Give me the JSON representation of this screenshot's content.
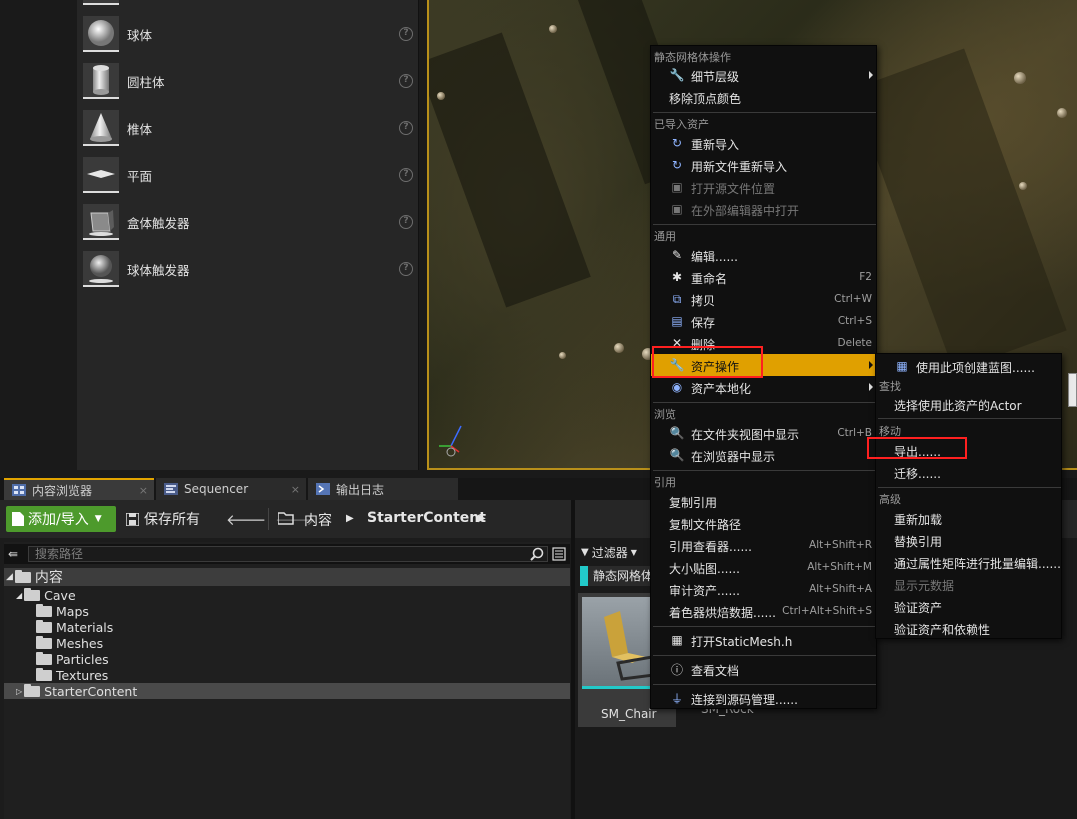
{
  "place_actors": {
    "items": [
      {
        "label": "球体",
        "icon": "sphere-icon"
      },
      {
        "label": "圆柱体",
        "icon": "cylinder-icon"
      },
      {
        "label": "椎体",
        "icon": "cone-icon"
      },
      {
        "label": "平面",
        "icon": "plane-icon"
      },
      {
        "label": "盒体触发器",
        "icon": "box-trigger-icon"
      },
      {
        "label": "球体触发器",
        "icon": "sphere-trigger-icon"
      }
    ],
    "help_glyph": "?"
  },
  "tabs": [
    {
      "label": "内容浏览器",
      "close": "×"
    },
    {
      "label": "Sequencer",
      "close": "×"
    },
    {
      "label": "输出日志",
      "close": "×"
    }
  ],
  "toolbar": {
    "add_import": "添加/导入",
    "save_all": "保存所有",
    "breadcrumb": [
      "内容",
      "StarterContent"
    ]
  },
  "paths": {
    "search_placeholder": "搜索路径",
    "tree": [
      {
        "label": "内容",
        "level": 0
      },
      {
        "label": "Cave",
        "level": 1
      },
      {
        "label": "Maps",
        "level": 2
      },
      {
        "label": "Materials",
        "level": 2
      },
      {
        "label": "Meshes",
        "level": 2
      },
      {
        "label": "Particles",
        "level": 2
      },
      {
        "label": "Textures",
        "level": 2
      },
      {
        "label": "StarterContent",
        "level": 1
      }
    ]
  },
  "assets": {
    "filter_label": "过滤器",
    "type_header": "静态网格体",
    "tiles": [
      "SM_Chair",
      "SM_Rock"
    ]
  },
  "context_menu": {
    "sections": {
      "mesh_ops": "静态网格体操作",
      "imported": "已导入资产",
      "common": "通用",
      "browse": "浏览",
      "references": "引用"
    },
    "items": {
      "lod": "细节层级",
      "remove_vertex_colors": "移除顶点颜色",
      "reimport": "重新导入",
      "reimport_new_file": "用新文件重新导入",
      "open_source_location": "打开源文件位置",
      "open_external_editor": "在外部编辑器中打开",
      "edit": "编辑......",
      "rename": "重命名",
      "rename_sc": "F2",
      "copy": "拷贝",
      "copy_sc": "Ctrl+W",
      "save": "保存",
      "save_sc": "Ctrl+S",
      "delete": "删除",
      "delete_sc": "Delete",
      "asset_actions": "资产操作",
      "asset_localization": "资产本地化",
      "show_in_folder": "在文件夹视图中显示",
      "show_in_folder_sc": "Ctrl+B",
      "show_in_browser": "在浏览器中显示",
      "copy_reference": "复制引用",
      "copy_file_path": "复制文件路径",
      "reference_viewer": "引用查看器......",
      "reference_viewer_sc": "Alt+Shift+R",
      "size_map": "大小贴图......",
      "size_map_sc": "Alt+Shift+M",
      "audit_assets": "审计资产......",
      "audit_assets_sc": "Alt+Shift+A",
      "shader_cook": "着色器烘焙数据......",
      "shader_cook_sc": "Ctrl+Alt+Shift+S",
      "open_header": "打开StaticMesh.h",
      "view_docs": "查看文档",
      "connect_source_control": "连接到源码管理......"
    }
  },
  "submenu": {
    "create_blueprint": "使用此项创建蓝图......",
    "find_section": "查找",
    "select_actors": "选择使用此资产的Actor",
    "move_section": "移动",
    "export": "导出......",
    "migrate": "迁移......",
    "advanced_section": "高级",
    "reload": "重新加载",
    "replace_references": "替换引用",
    "bulk_edit": "通过属性矩阵进行批量编辑......",
    "show_metadata": "显示元数据",
    "validate": "验证资产",
    "validate_deps": "验证资产和依赖性"
  },
  "colors": {
    "highlight": "#e0a000",
    "add_button": "#4d9a2c",
    "annotation_box": "#ff2020"
  }
}
